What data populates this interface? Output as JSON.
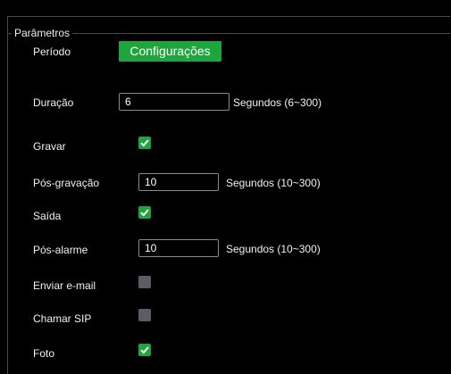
{
  "section": {
    "title": "Parâmetros"
  },
  "periodo": {
    "label": "Período",
    "button": "Configurações"
  },
  "duracao": {
    "label": "Duração",
    "value": "6",
    "hint": "Segundos (6~300)"
  },
  "gravar": {
    "label": "Gravar",
    "checked": true
  },
  "pos_gravacao": {
    "label": "Pós-gravação",
    "value": "10",
    "hint": "Segundos (10~300)"
  },
  "saida": {
    "label": "Saída",
    "checked": true
  },
  "pos_alarme": {
    "label": "Pós-alarme",
    "value": "10",
    "hint": "Segundos (10~300)"
  },
  "enviar_email": {
    "label": "Enviar e-mail",
    "checked": false
  },
  "chamar_sip": {
    "label": "Chamar SIP",
    "checked": false
  },
  "foto": {
    "label": "Foto",
    "checked": true
  },
  "colors": {
    "accent": "#1fa53d",
    "unchecked": "#5a5d63",
    "background": "#000000"
  }
}
